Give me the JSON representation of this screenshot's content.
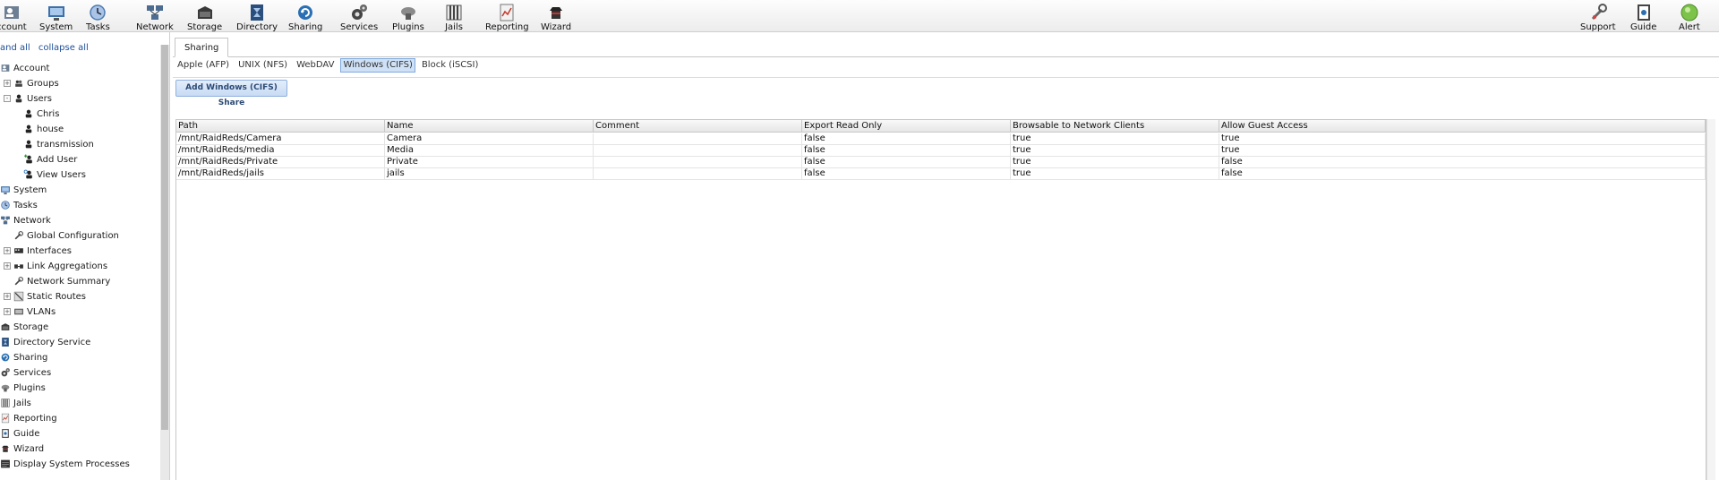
{
  "toolbar": {
    "items": [
      {
        "label": "ccount",
        "icon": "account-icon"
      },
      {
        "label": "System",
        "icon": "system-icon"
      },
      {
        "label": "Tasks",
        "icon": "tasks-icon"
      },
      {
        "label": "Network",
        "icon": "network-icon"
      },
      {
        "label": "Storage",
        "icon": "storage-icon"
      },
      {
        "label": "Directory",
        "icon": "directory-icon"
      },
      {
        "label": "Sharing",
        "icon": "sharing-icon"
      },
      {
        "label": "Services",
        "icon": "services-icon"
      },
      {
        "label": "Plugins",
        "icon": "plugins-icon"
      },
      {
        "label": "Jails",
        "icon": "jails-icon"
      },
      {
        "label": "Reporting",
        "icon": "reporting-icon"
      },
      {
        "label": "Wizard",
        "icon": "wizard-icon"
      }
    ],
    "right_items": [
      {
        "label": "Support",
        "icon": "support-icon"
      },
      {
        "label": "Guide",
        "icon": "guide-icon"
      },
      {
        "label": "Alert",
        "icon": "alert-icon"
      }
    ]
  },
  "sidebar": {
    "expand_all": "and all",
    "collapse_all": "collapse all",
    "tree": [
      {
        "label": "Account",
        "icon": "account-icon",
        "level": 0
      },
      {
        "label": "Groups",
        "icon": "groups-icon",
        "level": 1,
        "toggle": "+"
      },
      {
        "label": "Users",
        "icon": "users-icon",
        "level": 1,
        "toggle": "-"
      },
      {
        "label": "Chris",
        "icon": "user-icon",
        "level": 2
      },
      {
        "label": "house",
        "icon": "user-icon",
        "level": 2
      },
      {
        "label": "transmission",
        "icon": "user-icon",
        "level": 2
      },
      {
        "label": "Add User",
        "icon": "add-user-icon",
        "level": 2
      },
      {
        "label": "View Users",
        "icon": "view-users-icon",
        "level": 2
      },
      {
        "label": "System",
        "icon": "system-icon",
        "level": 0
      },
      {
        "label": "Tasks",
        "icon": "tasks-icon",
        "level": 0
      },
      {
        "label": "Network",
        "icon": "network-icon",
        "level": 0
      },
      {
        "label": "Global Configuration",
        "icon": "wrench-icon",
        "level": 1
      },
      {
        "label": "Interfaces",
        "icon": "interfaces-icon",
        "level": 1,
        "toggle": "+"
      },
      {
        "label": "Link Aggregations",
        "icon": "link-aggregation-icon",
        "level": 1,
        "toggle": "+"
      },
      {
        "label": "Network Summary",
        "icon": "wrench-icon",
        "level": 1
      },
      {
        "label": "Static Routes",
        "icon": "static-routes-icon",
        "level": 1,
        "toggle": "+"
      },
      {
        "label": "VLANs",
        "icon": "vlans-icon",
        "level": 1,
        "toggle": "+"
      },
      {
        "label": "Storage",
        "icon": "storage-icon",
        "level": 0
      },
      {
        "label": "Directory Service",
        "icon": "directory-icon",
        "level": 0
      },
      {
        "label": "Sharing",
        "icon": "sharing-icon",
        "level": 0
      },
      {
        "label": "Services",
        "icon": "services-icon",
        "level": 0
      },
      {
        "label": "Plugins",
        "icon": "plugins-icon",
        "level": 0
      },
      {
        "label": "Jails",
        "icon": "jails-icon",
        "level": 0
      },
      {
        "label": "Reporting",
        "icon": "reporting-icon",
        "level": 0
      },
      {
        "label": "Guide",
        "icon": "guide-icon",
        "level": 0
      },
      {
        "label": "Wizard",
        "icon": "wizard-icon",
        "level": 0
      },
      {
        "label": "Display System Processes",
        "icon": "processes-icon",
        "level": 0
      }
    ]
  },
  "main": {
    "outer_tab": "Sharing",
    "sub_tabs": [
      "Apple (AFP)",
      "UNIX (NFS)",
      "WebDAV",
      "Windows (CIFS)",
      "Block (iSCSI)"
    ],
    "active_sub_tab": "Windows (CIFS)",
    "add_button": "Add Windows (CIFS) Share",
    "table": {
      "columns": [
        "Path",
        "Name",
        "Comment",
        "Export Read Only",
        "Browsable to Network Clients",
        "Allow Guest Access"
      ],
      "rows": [
        [
          "/mnt/RaidReds/Camera",
          "Camera",
          "",
          "false",
          "true",
          "true"
        ],
        [
          "/mnt/RaidReds/media",
          "Media",
          "",
          "false",
          "true",
          "true"
        ],
        [
          "/mnt/RaidReds/Private",
          "Private",
          "",
          "false",
          "true",
          "false"
        ],
        [
          "/mnt/RaidReds/jails",
          "jails",
          "",
          "false",
          "true",
          "false"
        ]
      ]
    }
  },
  "colors": {
    "link": "#1f4e99",
    "active_tab_bg": "#cfe1f7",
    "button_bg": "#c7dbf3"
  }
}
